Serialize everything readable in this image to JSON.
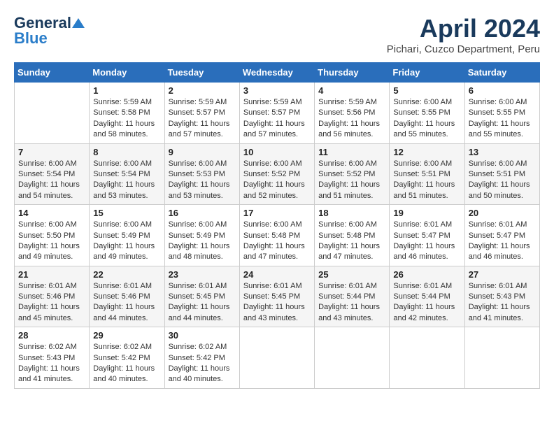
{
  "header": {
    "logo_general": "General",
    "logo_blue": "Blue",
    "month_title": "April 2024",
    "location": "Pichari, Cuzco Department, Peru"
  },
  "days_of_week": [
    "Sunday",
    "Monday",
    "Tuesday",
    "Wednesday",
    "Thursday",
    "Friday",
    "Saturday"
  ],
  "weeks": [
    [
      {
        "day": "",
        "sunrise": "",
        "sunset": "",
        "daylight": ""
      },
      {
        "day": "1",
        "sunrise": "Sunrise: 5:59 AM",
        "sunset": "Sunset: 5:58 PM",
        "daylight": "Daylight: 11 hours and 58 minutes."
      },
      {
        "day": "2",
        "sunrise": "Sunrise: 5:59 AM",
        "sunset": "Sunset: 5:57 PM",
        "daylight": "Daylight: 11 hours and 57 minutes."
      },
      {
        "day": "3",
        "sunrise": "Sunrise: 5:59 AM",
        "sunset": "Sunset: 5:57 PM",
        "daylight": "Daylight: 11 hours and 57 minutes."
      },
      {
        "day": "4",
        "sunrise": "Sunrise: 5:59 AM",
        "sunset": "Sunset: 5:56 PM",
        "daylight": "Daylight: 11 hours and 56 minutes."
      },
      {
        "day": "5",
        "sunrise": "Sunrise: 6:00 AM",
        "sunset": "Sunset: 5:55 PM",
        "daylight": "Daylight: 11 hours and 55 minutes."
      },
      {
        "day": "6",
        "sunrise": "Sunrise: 6:00 AM",
        "sunset": "Sunset: 5:55 PM",
        "daylight": "Daylight: 11 hours and 55 minutes."
      }
    ],
    [
      {
        "day": "7",
        "sunrise": "Sunrise: 6:00 AM",
        "sunset": "Sunset: 5:54 PM",
        "daylight": "Daylight: 11 hours and 54 minutes."
      },
      {
        "day": "8",
        "sunrise": "Sunrise: 6:00 AM",
        "sunset": "Sunset: 5:54 PM",
        "daylight": "Daylight: 11 hours and 53 minutes."
      },
      {
        "day": "9",
        "sunrise": "Sunrise: 6:00 AM",
        "sunset": "Sunset: 5:53 PM",
        "daylight": "Daylight: 11 hours and 53 minutes."
      },
      {
        "day": "10",
        "sunrise": "Sunrise: 6:00 AM",
        "sunset": "Sunset: 5:52 PM",
        "daylight": "Daylight: 11 hours and 52 minutes."
      },
      {
        "day": "11",
        "sunrise": "Sunrise: 6:00 AM",
        "sunset": "Sunset: 5:52 PM",
        "daylight": "Daylight: 11 hours and 51 minutes."
      },
      {
        "day": "12",
        "sunrise": "Sunrise: 6:00 AM",
        "sunset": "Sunset: 5:51 PM",
        "daylight": "Daylight: 11 hours and 51 minutes."
      },
      {
        "day": "13",
        "sunrise": "Sunrise: 6:00 AM",
        "sunset": "Sunset: 5:51 PM",
        "daylight": "Daylight: 11 hours and 50 minutes."
      }
    ],
    [
      {
        "day": "14",
        "sunrise": "Sunrise: 6:00 AM",
        "sunset": "Sunset: 5:50 PM",
        "daylight": "Daylight: 11 hours and 49 minutes."
      },
      {
        "day": "15",
        "sunrise": "Sunrise: 6:00 AM",
        "sunset": "Sunset: 5:49 PM",
        "daylight": "Daylight: 11 hours and 49 minutes."
      },
      {
        "day": "16",
        "sunrise": "Sunrise: 6:00 AM",
        "sunset": "Sunset: 5:49 PM",
        "daylight": "Daylight: 11 hours and 48 minutes."
      },
      {
        "day": "17",
        "sunrise": "Sunrise: 6:00 AM",
        "sunset": "Sunset: 5:48 PM",
        "daylight": "Daylight: 11 hours and 47 minutes."
      },
      {
        "day": "18",
        "sunrise": "Sunrise: 6:00 AM",
        "sunset": "Sunset: 5:48 PM",
        "daylight": "Daylight: 11 hours and 47 minutes."
      },
      {
        "day": "19",
        "sunrise": "Sunrise: 6:01 AM",
        "sunset": "Sunset: 5:47 PM",
        "daylight": "Daylight: 11 hours and 46 minutes."
      },
      {
        "day": "20",
        "sunrise": "Sunrise: 6:01 AM",
        "sunset": "Sunset: 5:47 PM",
        "daylight": "Daylight: 11 hours and 46 minutes."
      }
    ],
    [
      {
        "day": "21",
        "sunrise": "Sunrise: 6:01 AM",
        "sunset": "Sunset: 5:46 PM",
        "daylight": "Daylight: 11 hours and 45 minutes."
      },
      {
        "day": "22",
        "sunrise": "Sunrise: 6:01 AM",
        "sunset": "Sunset: 5:46 PM",
        "daylight": "Daylight: 11 hours and 44 minutes."
      },
      {
        "day": "23",
        "sunrise": "Sunrise: 6:01 AM",
        "sunset": "Sunset: 5:45 PM",
        "daylight": "Daylight: 11 hours and 44 minutes."
      },
      {
        "day": "24",
        "sunrise": "Sunrise: 6:01 AM",
        "sunset": "Sunset: 5:45 PM",
        "daylight": "Daylight: 11 hours and 43 minutes."
      },
      {
        "day": "25",
        "sunrise": "Sunrise: 6:01 AM",
        "sunset": "Sunset: 5:44 PM",
        "daylight": "Daylight: 11 hours and 43 minutes."
      },
      {
        "day": "26",
        "sunrise": "Sunrise: 6:01 AM",
        "sunset": "Sunset: 5:44 PM",
        "daylight": "Daylight: 11 hours and 42 minutes."
      },
      {
        "day": "27",
        "sunrise": "Sunrise: 6:01 AM",
        "sunset": "Sunset: 5:43 PM",
        "daylight": "Daylight: 11 hours and 41 minutes."
      }
    ],
    [
      {
        "day": "28",
        "sunrise": "Sunrise: 6:02 AM",
        "sunset": "Sunset: 5:43 PM",
        "daylight": "Daylight: 11 hours and 41 minutes."
      },
      {
        "day": "29",
        "sunrise": "Sunrise: 6:02 AM",
        "sunset": "Sunset: 5:42 PM",
        "daylight": "Daylight: 11 hours and 40 minutes."
      },
      {
        "day": "30",
        "sunrise": "Sunrise: 6:02 AM",
        "sunset": "Sunset: 5:42 PM",
        "daylight": "Daylight: 11 hours and 40 minutes."
      },
      {
        "day": "",
        "sunrise": "",
        "sunset": "",
        "daylight": ""
      },
      {
        "day": "",
        "sunrise": "",
        "sunset": "",
        "daylight": ""
      },
      {
        "day": "",
        "sunrise": "",
        "sunset": "",
        "daylight": ""
      },
      {
        "day": "",
        "sunrise": "",
        "sunset": "",
        "daylight": ""
      }
    ]
  ]
}
